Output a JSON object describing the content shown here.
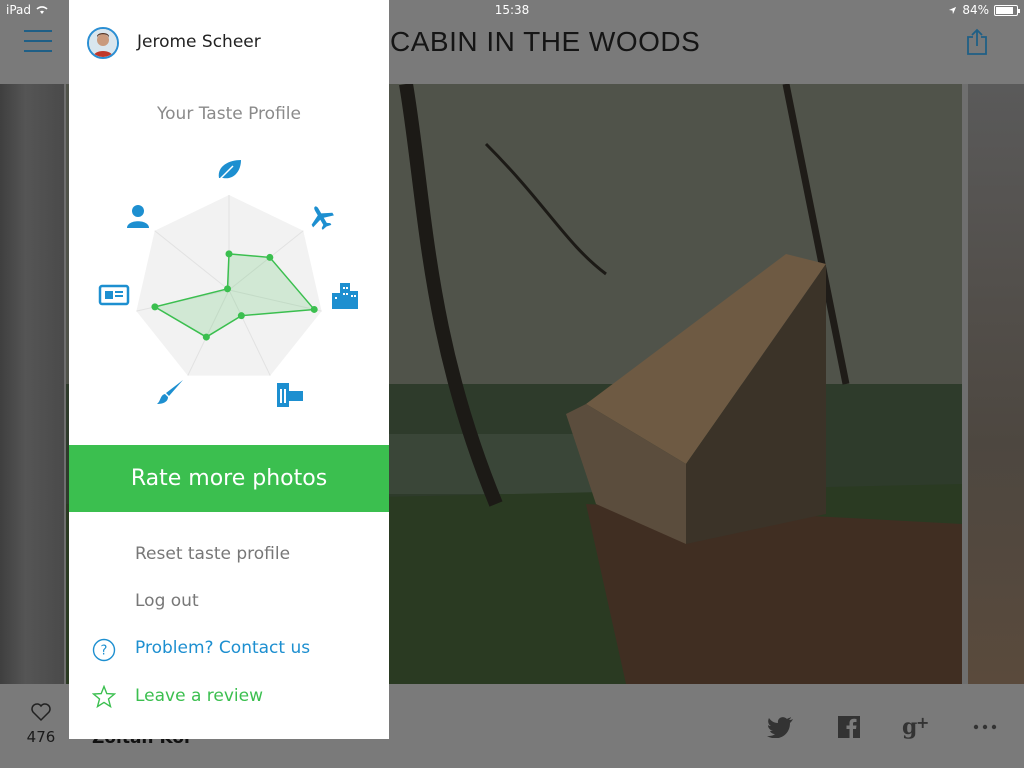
{
  "status_bar": {
    "device": "iPad",
    "time": "15:38",
    "battery": "84%",
    "battery_level": 0.84
  },
  "photo": {
    "title": "CABIN IN THE WOODS",
    "likes": "476",
    "author": "Zoltan Kor"
  },
  "drawer": {
    "user_name": "Jerome Scheer",
    "taste_title": "Your Taste Profile",
    "radar_categories": [
      "nature-icon",
      "travel-icon",
      "city-icon",
      "architecture-icon",
      "art-icon",
      "journalism-icon",
      "people-icon"
    ],
    "radar_values": [
      0.38,
      0.55,
      0.92,
      0.3,
      0.55,
      0.8,
      0.0
    ],
    "accent_blue": "#1d8fd0",
    "accent_green": "#3bbf4f",
    "rate_button": "Rate more photos",
    "reset": "Reset taste profile",
    "logout": "Log out",
    "contact": "Problem? Contact us",
    "review": "Leave a review"
  },
  "social": [
    "twitter-icon",
    "facebook-icon",
    "google-plus-icon",
    "more-icon"
  ]
}
